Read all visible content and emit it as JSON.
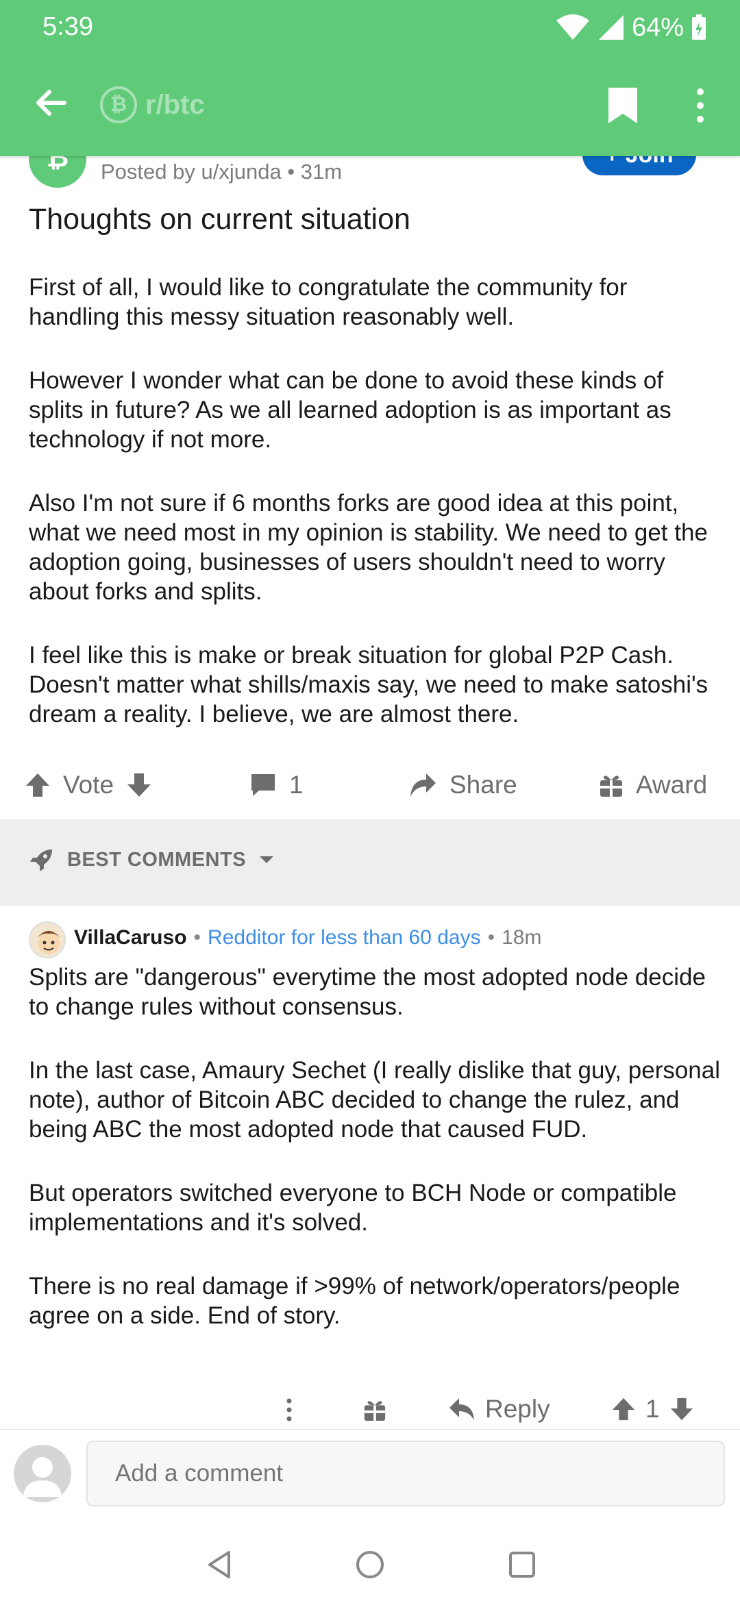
{
  "status_bar": {
    "time": "5:39",
    "battery": "64%"
  },
  "app_bar": {
    "subreddit": "r/btc",
    "coin_symbol": "₿"
  },
  "post": {
    "posted_by": "Posted by u/xjunda • 31m",
    "join_label": "+ Join",
    "title": "Thoughts on current situation",
    "paragraphs": [
      "First of all, I would like to congratulate the community for handling this messy situation reasonably well.",
      "However I wonder what can be done to avoid these kinds of splits in future? As we all learned adoption is as important as technology if not more.",
      "Also I'm not sure if 6 months forks are good idea at this point, what we need most in my opinion is stability. We need to get the adoption going, businesses of users shouldn't need to worry about forks and splits.",
      "I feel like this is make or break situation for global P2P Cash. Doesn't matter what shills/maxis say, we need to make satoshi's dream a reality. I believe, we are almost there."
    ],
    "actions": {
      "vote": "Vote",
      "comments": "1",
      "share": "Share",
      "award": "Award"
    }
  },
  "sort": {
    "label": "BEST COMMENTS"
  },
  "comment": {
    "user": "VillaCaruso",
    "flair": "Redditor for less than 60 days",
    "time": "18m",
    "paragraphs": [
      "Splits are \"dangerous\" everytime the most adopted node decide to change rules without consensus.",
      "In the last case, Amaury Sechet (I really dislike that guy, personal note), author of Bitcoin ABC decided to change the rulez, and being ABC the most adopted node that caused FUD.",
      "But operators switched everyone to BCH Node or compatible implementations and it's solved.",
      "There is no real damage if >99% of network/operators/people agree on a side. End of story."
    ],
    "actions": {
      "reply": "Reply",
      "score": "1"
    }
  },
  "composer": {
    "placeholder": "Add a comment"
  },
  "colors": {
    "header": "#5fca78",
    "join": "#0a66c2",
    "flair": "#3d8ee6"
  }
}
